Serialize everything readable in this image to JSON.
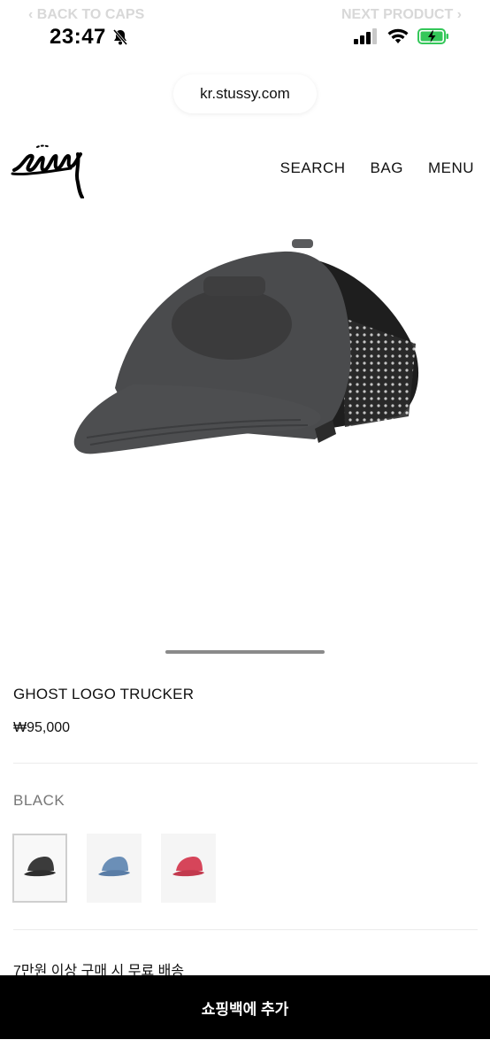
{
  "ghost_nav": {
    "back": "‹ BACK TO CAPS",
    "next": "NEXT PRODUCT ›"
  },
  "status": {
    "time": "23:47"
  },
  "browser": {
    "url": "kr.stussy.com"
  },
  "header": {
    "nav": [
      "SEARCH",
      "BAG",
      "MENU"
    ]
  },
  "product": {
    "title": "GHOST LOGO TRUCKER",
    "price": "₩95,000",
    "color_label": "BLACK",
    "swatches": [
      {
        "name": "black",
        "color": "#3b3b3b"
      },
      {
        "name": "blue",
        "color": "#6b8fb7"
      },
      {
        "name": "red",
        "color": "#d6455a"
      }
    ],
    "shipping_note": "7만원 이상 구매 시 무료 배송"
  },
  "cta": {
    "label": "쇼핑백에 추가"
  },
  "colors": {
    "cta_bg": "#000000",
    "accent_battery": "#34c759"
  }
}
